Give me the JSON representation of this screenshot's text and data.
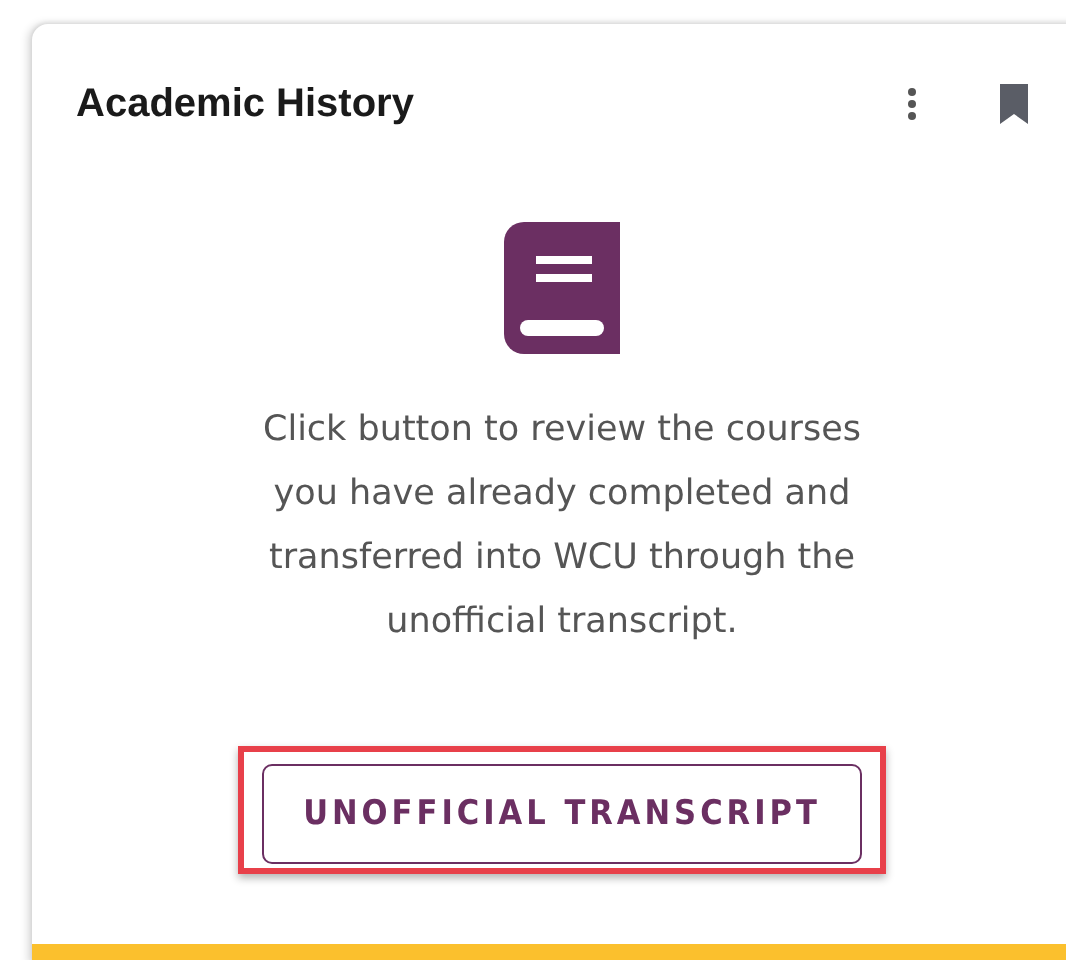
{
  "card": {
    "title": "Academic History",
    "description": "Click button to review the courses you have already completed and transferred into WCU through the unofficial transcript.",
    "button": {
      "label": "UNOFFICIAL TRANSCRIPT",
      "highlighted": true
    }
  }
}
